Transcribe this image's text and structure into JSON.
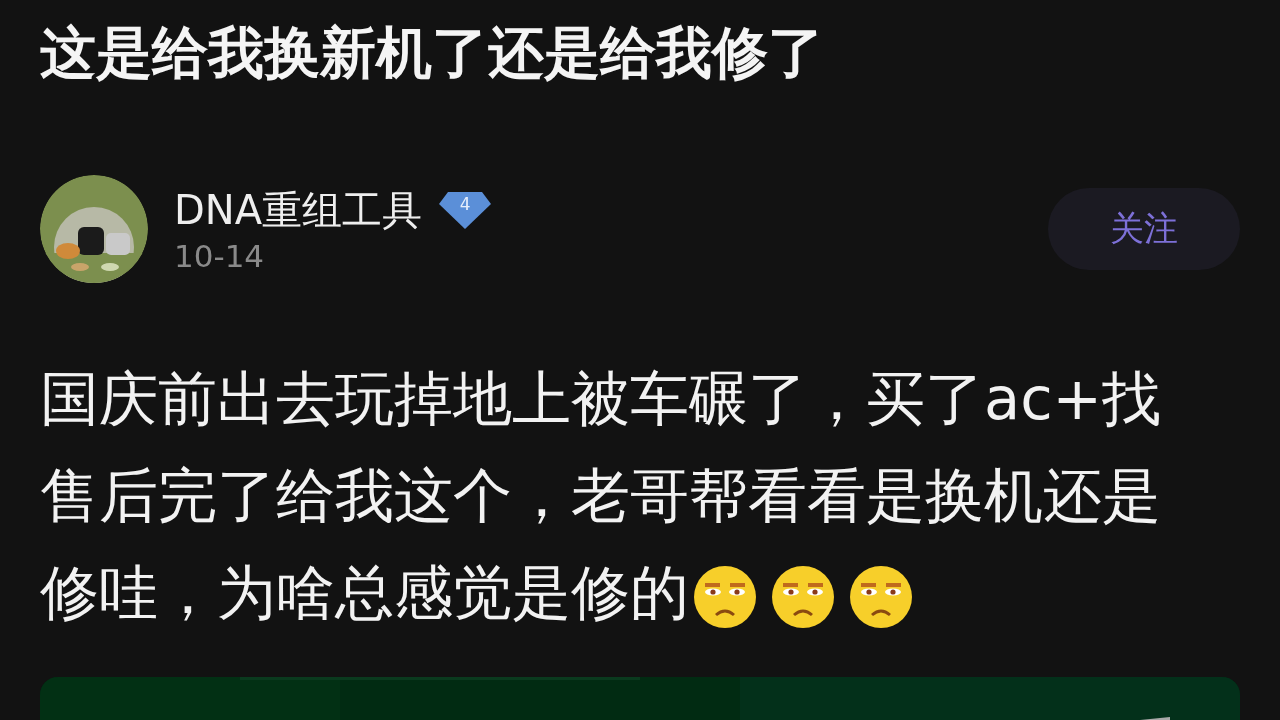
{
  "post": {
    "title": "这是给我换新机了还是给我修了",
    "author": {
      "name": "DNA重组工具",
      "level_badge": "4",
      "date": "10-14"
    },
    "follow_button": {
      "label": "关注",
      "following": false
    },
    "body": "国庆前出去玩掉地上被车碾了，买了ac+找售后完了给我这个，老哥帮看看是换机还是修哇，为啥总感觉是修的"
  }
}
